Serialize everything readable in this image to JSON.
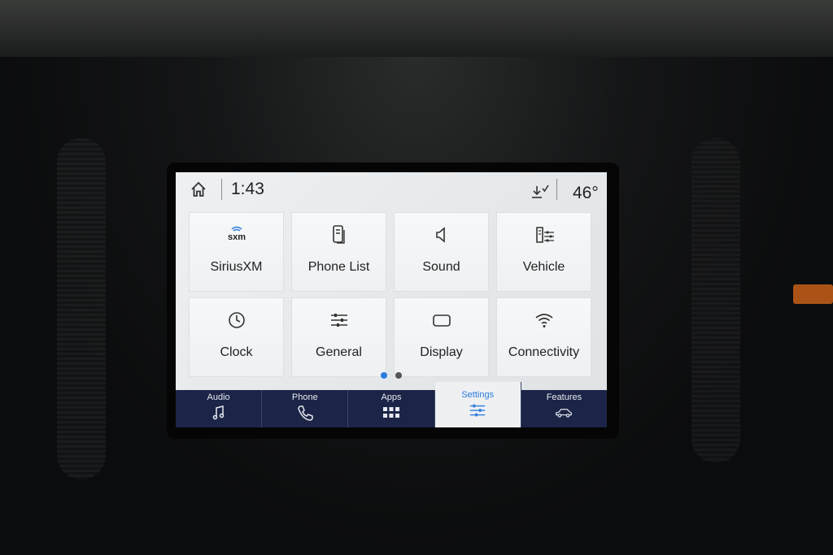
{
  "status_bar": {
    "time": "1:43",
    "temperature": "46°"
  },
  "tiles": [
    {
      "label": "SiriusXM",
      "icon": "siriusxm-logo-icon"
    },
    {
      "label": "Phone List",
      "icon": "phone-list-icon"
    },
    {
      "label": "Sound",
      "icon": "speaker-icon"
    },
    {
      "label": "Vehicle",
      "icon": "vehicle-settings-icon"
    },
    {
      "label": "Clock",
      "icon": "clock-icon"
    },
    {
      "label": "General",
      "icon": "sliders-icon"
    },
    {
      "label": "Display",
      "icon": "display-icon"
    },
    {
      "label": "Connectivity",
      "icon": "wifi-icon"
    }
  ],
  "sxm_logo_text": "sxm",
  "page_indicator": {
    "current": 1,
    "total": 2
  },
  "nav": [
    {
      "label": "Audio",
      "icon": "music-note-icon",
      "active": false
    },
    {
      "label": "Phone",
      "icon": "phone-icon",
      "active": false
    },
    {
      "label": "Apps",
      "icon": "apps-grid-icon",
      "active": false
    },
    {
      "label": "Settings",
      "icon": "settings-sliders-icon",
      "active": true
    },
    {
      "label": "Features",
      "icon": "car-icon",
      "active": false
    }
  ],
  "colors": {
    "nav_background": "#1c2547",
    "accent_blue": "#2d7be0"
  }
}
